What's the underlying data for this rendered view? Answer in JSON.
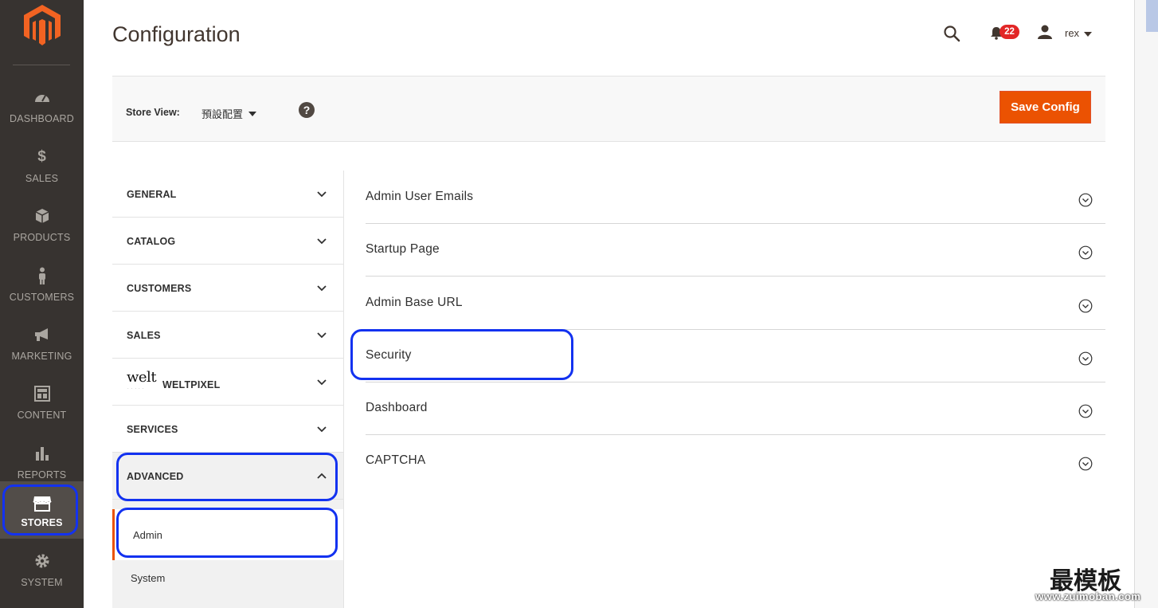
{
  "nav": {
    "items": [
      {
        "label": "DASHBOARD",
        "icon": "dashboard-icon"
      },
      {
        "label": "SALES",
        "icon": "dollar-icon"
      },
      {
        "label": "PRODUCTS",
        "icon": "box-icon"
      },
      {
        "label": "CUSTOMERS",
        "icon": "person-icon"
      },
      {
        "label": "MARKETING",
        "icon": "megaphone-icon"
      },
      {
        "label": "CONTENT",
        "icon": "layout-icon"
      },
      {
        "label": "REPORTS",
        "icon": "bar-chart-icon"
      },
      {
        "label": "STORES",
        "icon": "storefront-icon",
        "active": true
      },
      {
        "label": "SYSTEM",
        "icon": "gear-icon"
      }
    ]
  },
  "header": {
    "title": "Configuration",
    "notifications_count": "22",
    "username": "rex"
  },
  "store_switcher": {
    "label": "Store View:",
    "value": "預設配置",
    "help": "?"
  },
  "actions": {
    "save_label": "Save Config"
  },
  "config_tabs": [
    {
      "label": "GENERAL"
    },
    {
      "label": "CATALOG"
    },
    {
      "label": "CUSTOMERS"
    },
    {
      "label": "SALES"
    },
    {
      "label": "WELTPIXEL",
      "logo_text": "welt"
    },
    {
      "label": "SERVICES"
    },
    {
      "label": "ADVANCED",
      "expanded": true
    }
  ],
  "advanced_items": [
    {
      "label": "Admin",
      "current": true
    },
    {
      "label": "System"
    }
  ],
  "sections": [
    {
      "title": "Admin User Emails"
    },
    {
      "title": "Startup Page"
    },
    {
      "title": "Admin Base URL"
    },
    {
      "title": "Security"
    },
    {
      "title": "Dashboard"
    },
    {
      "title": "CAPTCHA"
    }
  ],
  "watermark": {
    "title": "最模板",
    "url": "www.zuimoban.com"
  },
  "colors": {
    "nav_bg": "#373330",
    "accent": "#eb5202",
    "highlight_ring": "#1332f0",
    "badge": "#e22626"
  }
}
